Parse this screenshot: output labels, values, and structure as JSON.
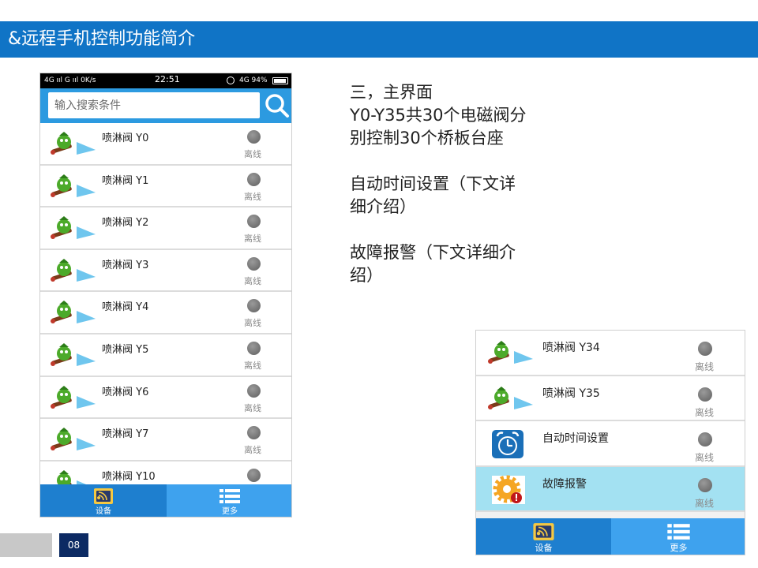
{
  "slide": {
    "title": "&远程手机控制功能简介",
    "page_number": "08"
  },
  "colors": {
    "title_bar": "#1074c6",
    "app_blue": "#2c9ae0",
    "tab_active": "#1e7fcf",
    "tab_inactive": "#3ea2ee",
    "highlight_row": "#a3e1f2",
    "page_badge": "#0c2a63"
  },
  "phone": {
    "status_bar": {
      "left": "4G ııl G ııl 0K/s",
      "time": "22:51",
      "right": "4G 94%"
    },
    "search": {
      "placeholder": "输入搜索条件",
      "icon": "search-icon"
    },
    "rows": [
      {
        "label": "喷淋阀 Y0",
        "status": "离线",
        "icon": "sprinkler-icon"
      },
      {
        "label": "喷淋阀 Y1",
        "status": "离线",
        "icon": "sprinkler-icon"
      },
      {
        "label": "喷淋阀 Y2",
        "status": "离线",
        "icon": "sprinkler-icon"
      },
      {
        "label": "喷淋阀 Y3",
        "status": "离线",
        "icon": "sprinkler-icon"
      },
      {
        "label": "喷淋阀 Y4",
        "status": "离线",
        "icon": "sprinkler-icon"
      },
      {
        "label": "喷淋阀 Y5",
        "status": "离线",
        "icon": "sprinkler-icon"
      },
      {
        "label": "喷淋阀 Y6",
        "status": "离线",
        "icon": "sprinkler-icon"
      },
      {
        "label": "喷淋阀 Y7",
        "status": "离线",
        "icon": "sprinkler-icon"
      },
      {
        "label": "喷淋阀 Y10",
        "status": "",
        "icon": "sprinkler-icon"
      }
    ],
    "tabs": [
      {
        "label": "设备",
        "icon": "device-icon"
      },
      {
        "label": "更多",
        "icon": "list-icon"
      }
    ]
  },
  "info": {
    "heading": "三，主界面",
    "line1": "Y0-Y35共30个电磁阀分",
    "line2": "别控制30个桥板台座",
    "line3": "自动时间设置（下文详",
    "line4": "细介绍）",
    "line5": "故障报警（下文详细介",
    "line6": "绍）"
  },
  "phone2": {
    "rows": [
      {
        "label": "喷淋阀 Y34",
        "status": "离线",
        "icon": "sprinkler-icon"
      },
      {
        "label": "喷淋阀 Y35",
        "status": "离线",
        "icon": "sprinkler-icon"
      },
      {
        "label": "自动时间设置",
        "status": "离线",
        "icon": "alarm-clock-icon"
      },
      {
        "label": "故障报警",
        "status": "离线",
        "icon": "fault-gear-icon"
      }
    ],
    "tabs": [
      {
        "label": "设备",
        "icon": "device-icon"
      },
      {
        "label": "更多",
        "icon": "list-icon"
      }
    ]
  }
}
